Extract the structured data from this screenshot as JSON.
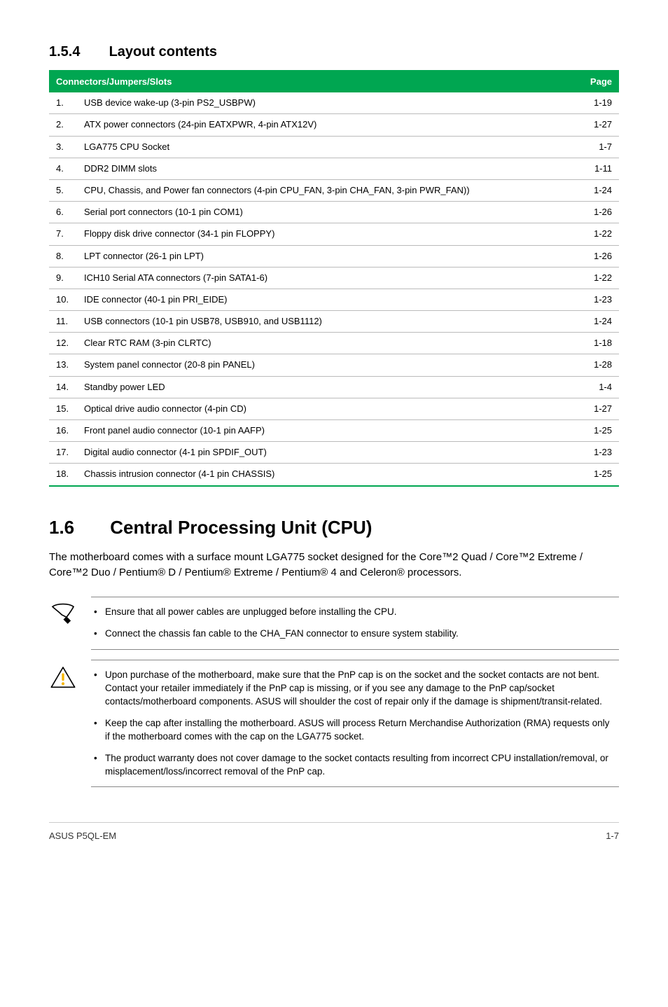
{
  "section154": {
    "num": "1.5.4",
    "title": "Layout contents"
  },
  "table": {
    "header_left": "Connectors/Jumpers/Slots",
    "header_right": "Page",
    "rows": [
      {
        "n": "1.",
        "desc": "USB device wake-up (3-pin PS2_USBPW)",
        "page": "1-19"
      },
      {
        "n": "2.",
        "desc": "ATX power connectors (24-pin EATXPWR, 4-pin ATX12V)",
        "page": "1-27"
      },
      {
        "n": "3.",
        "desc": "LGA775 CPU Socket",
        "page": "1-7"
      },
      {
        "n": "4.",
        "desc": "DDR2 DIMM slots",
        "page": "1-11"
      },
      {
        "n": "5.",
        "desc": "CPU, Chassis, and Power fan connectors (4-pin CPU_FAN, 3-pin CHA_FAN, 3-pin PWR_FAN))",
        "page": "1-24"
      },
      {
        "n": "6.",
        "desc": "Serial port connectors (10-1 pin COM1)",
        "page": "1-26"
      },
      {
        "n": "7.",
        "desc": "Floppy disk drive connector (34-1 pin FLOPPY)",
        "page": "1-22"
      },
      {
        "n": "8.",
        "desc": "LPT connector (26-1 pin LPT)",
        "page": "1-26"
      },
      {
        "n": "9.",
        "desc": "ICH10 Serial ATA connectors (7-pin SATA1-6)",
        "page": "1-22"
      },
      {
        "n": "10.",
        "desc": "IDE connector (40-1 pin PRI_EIDE)",
        "page": "1-23"
      },
      {
        "n": "11.",
        "desc": "USB connectors (10-1 pin USB78, USB910, and USB1112)",
        "page": "1-24"
      },
      {
        "n": "12.",
        "desc": "Clear RTC RAM (3-pin CLRTC)",
        "page": "1-18"
      },
      {
        "n": "13.",
        "desc": "System panel connector (20-8 pin PANEL)",
        "page": "1-28"
      },
      {
        "n": "14.",
        "desc": "Standby power LED",
        "page": "1-4"
      },
      {
        "n": "15.",
        "desc": "Optical drive audio connector (4-pin CD)",
        "page": "1-27"
      },
      {
        "n": "16.",
        "desc": "Front panel audio connector (10-1 pin AAFP)",
        "page": "1-25"
      },
      {
        "n": "17.",
        "desc": "Digital audio connector (4-1 pin SPDIF_OUT)",
        "page": "1-23"
      },
      {
        "n": "18.",
        "desc": "Chassis intrusion connector (4-1 pin CHASSIS)",
        "page": "1-25"
      }
    ]
  },
  "section16": {
    "num": "1.6",
    "title": "Central Processing Unit (CPU)",
    "paragraph": "The motherboard comes with a surface mount LGA775 socket designed for the Core™2 Quad / Core™2 Extreme / Core™2 Duo / Pentium® D / Pentium® Extreme / Pentium® 4 and Celeron® processors."
  },
  "note1": {
    "items": [
      "Ensure that all power cables are unplugged before installing the CPU.",
      "Connect the chassis fan cable to the CHA_FAN connector to ensure system stability."
    ]
  },
  "note2": {
    "items": [
      "Upon purchase of the motherboard, make sure that the PnP cap is on the socket and the socket contacts are not bent. Contact your retailer immediately if the PnP cap is missing, or if you see any damage to the PnP cap/socket contacts/motherboard components. ASUS will shoulder the cost of repair only if the damage is shipment/transit-related.",
      "Keep the cap after installing the motherboard. ASUS will process Return Merchandise Authorization (RMA) requests only if the motherboard comes with the cap on the LGA775 socket.",
      "The product warranty does not cover damage to the socket contacts resulting from incorrect CPU installation/removal, or misplacement/loss/incorrect removal of the PnP cap."
    ]
  },
  "footer": {
    "left": "ASUS P5QL-EM",
    "right": "1-7"
  }
}
